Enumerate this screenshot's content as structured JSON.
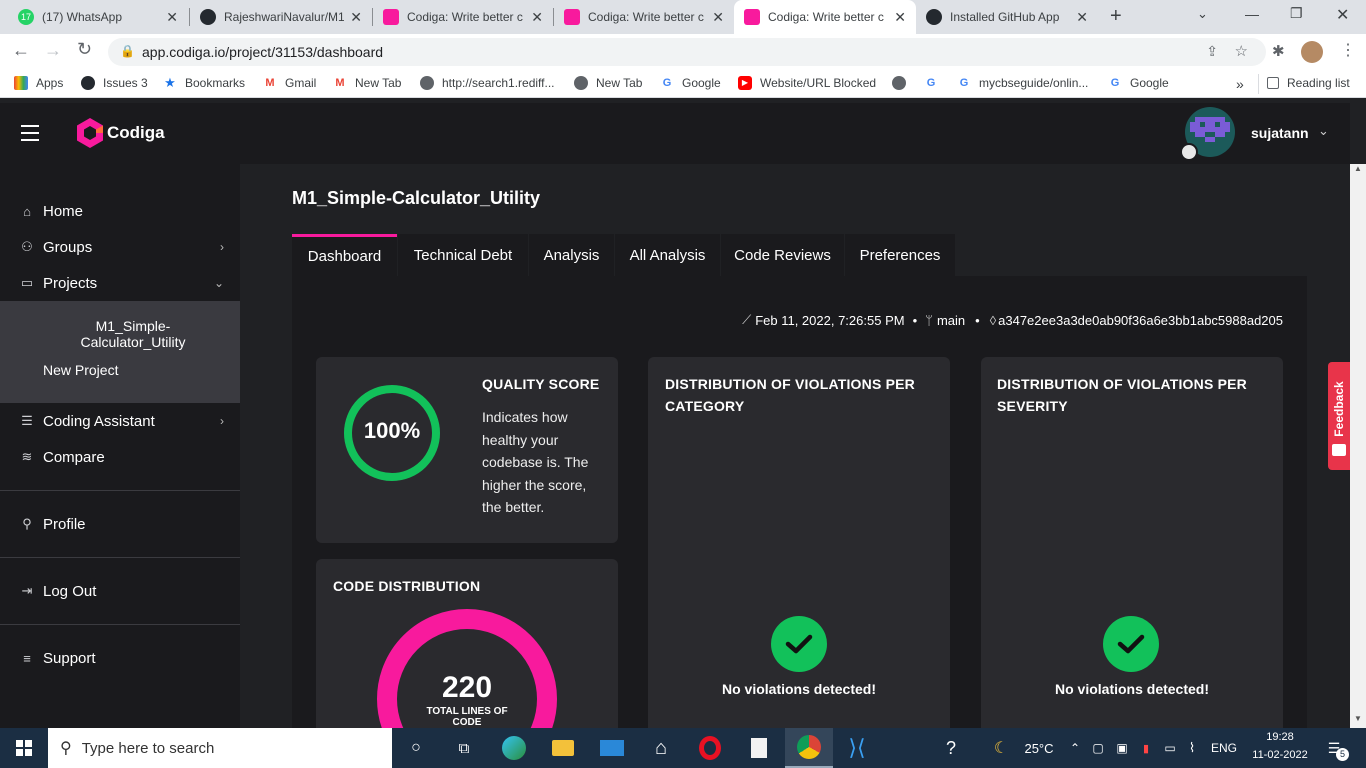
{
  "browser": {
    "tabs": [
      {
        "title": "(17) WhatsApp",
        "badge": "17"
      },
      {
        "title": "RajeshwariNavalur/M1"
      },
      {
        "title": "Codiga: Write better c"
      },
      {
        "title": "Codiga: Write better c"
      },
      {
        "title": "Codiga: Write better c"
      },
      {
        "title": "Installed GitHub App"
      }
    ],
    "url": "app.codiga.io/project/31153/dashboard",
    "bookmarks": [
      "Apps",
      "Issues 3",
      "Bookmarks",
      "Gmail",
      "New Tab",
      "http://search1.rediff...",
      "New Tab",
      "Google",
      "Website/URL Blocked",
      "mycbseguide/onlin...",
      "Google"
    ],
    "reading_list": "Reading list",
    "overflow": "»"
  },
  "app": {
    "brand": "Codiga",
    "username": "sujatann",
    "sidebar": {
      "home": "Home",
      "groups": "Groups",
      "projects": "Projects",
      "project_item": "M1_Simple-Calculator_Utility",
      "new_project": "New Project",
      "coding_assistant": "Coding Assistant",
      "compare": "Compare",
      "profile": "Profile",
      "logout": "Log Out",
      "support": "Support"
    },
    "project_title": "M1_Simple-Calculator_Utility",
    "tabs": [
      "Dashboard",
      "Technical Debt",
      "Analysis",
      "All Analysis",
      "Code Reviews",
      "Preferences"
    ],
    "meta": {
      "date": "Feb 11, 2022, 7:26:55 PM",
      "branch": "main",
      "commit": "a347e2ee3a3de0ab90f36a6e3bb1abc5988ad205"
    },
    "quality": {
      "title": "QUALITY SCORE",
      "value": "100%",
      "score_fraction": 1.0,
      "description": "Indicates how healthy your codebase is. The higher the score, the better."
    },
    "code_distribution": {
      "title": "CODE DISTRIBUTION",
      "value": "220",
      "caption": "TOTAL LINES OF CODE"
    },
    "violations_category": {
      "title": "DISTRIBUTION OF VIOLATIONS PER CATEGORY",
      "status": "No violations detected!"
    },
    "violations_severity": {
      "title": "DISTRIBUTION OF VIOLATIONS PER SEVERITY",
      "status": "No violations detected!"
    },
    "feedback": "Feedback"
  },
  "taskbar": {
    "search_placeholder": "Type here to search",
    "temperature": "25°C",
    "language": "ENG",
    "time": "19:28",
    "date": "11-02-2022",
    "notifications": "5"
  },
  "colors": {
    "accent_pink": "#f81a9d",
    "success_green": "#12c15a",
    "bg": "#202124",
    "card": "#2a2a2e"
  }
}
